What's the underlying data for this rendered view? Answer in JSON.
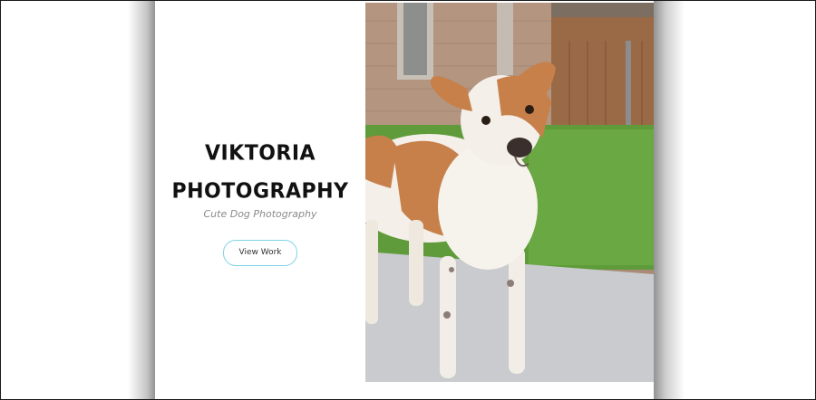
{
  "hero": {
    "title_line1": "VIKTORIA",
    "title_line2": "PHOTOGRAPHY",
    "subtitle": "Cute Dog Photography",
    "button_label": "View Work"
  },
  "photo": {
    "subject": "dog-photo"
  },
  "colors": {
    "button_border": "#7fd3e6",
    "title": "#111111",
    "subtitle": "#8a8a8a"
  }
}
